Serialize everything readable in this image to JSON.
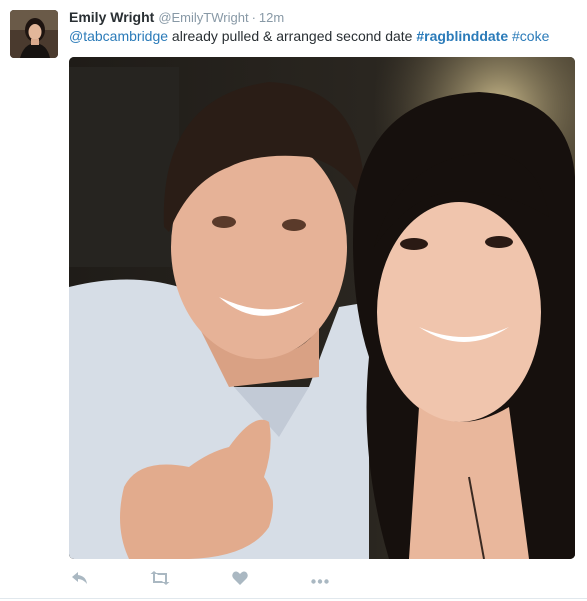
{
  "tweet": {
    "fullname": "Emily Wright",
    "username": "@EmilyTWright",
    "dot": "·",
    "time": "12m",
    "text_parts": {
      "mention": "@tabcambridge",
      "body": " already pulled & arranged second date ",
      "hashtag1": "#ragblinddate",
      "space": " ",
      "hashtag2": "#coke"
    },
    "photo_icon": "selfie-photo",
    "actions": {
      "reply": "reply-icon",
      "retweet": "retweet-icon",
      "like": "heart-icon",
      "more": "more-icon"
    }
  },
  "colors": {
    "link": "#2b7bb9",
    "muted": "#8899a6",
    "action": "#aab8c2",
    "divider": "#e1e8ed"
  }
}
